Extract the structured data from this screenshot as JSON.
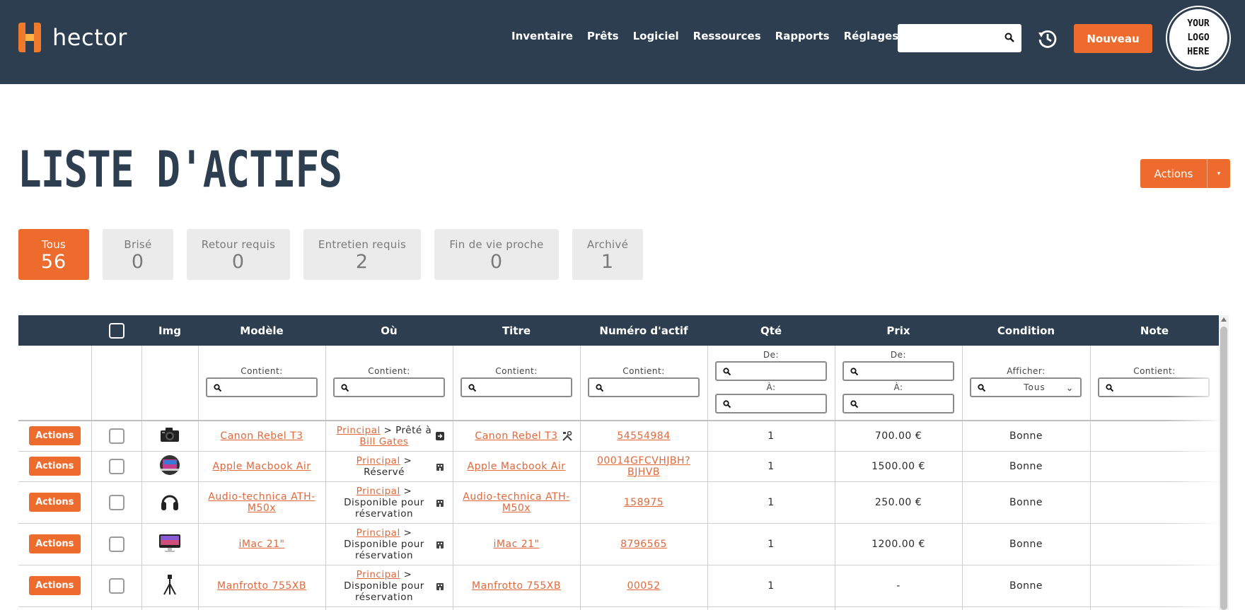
{
  "header": {
    "brand": "hector",
    "nav": [
      "Inventaire",
      "Prêts",
      "Logiciel",
      "Ressources",
      "Rapports",
      "Réglages"
    ],
    "search_placeholder": "",
    "new_button": "Nouveau",
    "logo_text": "YOUR\nLOGO\nHERE"
  },
  "page": {
    "title": "LISTE D'ACTIFS",
    "actions_button": "Actions",
    "actions_caret": "▾"
  },
  "tiles": [
    {
      "label": "Tous",
      "count": "56"
    },
    {
      "label": "Brisé",
      "count": "0"
    },
    {
      "label": "Retour requis",
      "count": "0"
    },
    {
      "label": "Entretien requis",
      "count": "2"
    },
    {
      "label": "Fin de vie proche",
      "count": "0"
    },
    {
      "label": "Archivé",
      "count": "1"
    }
  ],
  "table": {
    "columns": [
      "",
      "",
      "Img",
      "Modèle",
      "Où",
      "Titre",
      "Numéro d'actif",
      "Qté",
      "Prix",
      "Condition",
      "Note"
    ],
    "filters": {
      "contains_label": "Contient:",
      "from_label": "De:",
      "to_label": "À:",
      "show_label": "Afficher:",
      "show_value": "Tous"
    },
    "row_action_label": "Actions",
    "rows": [
      {
        "img": "camera-icon",
        "model": "Canon Rebel T3",
        "where_link": "Principal",
        "where_sep": " > Prêté à ",
        "where_user": "Bill Gates",
        "where_icon": "loan-out-icon",
        "title": "Canon Rebel T3",
        "title_icon": "maintenance-tools-icon",
        "asset": "54554984",
        "qty": "1",
        "price": "700.00 €",
        "condition": "Bonne",
        "note": ""
      },
      {
        "img": "laptop-icon",
        "model": "Apple Macbook Air",
        "where_link": "Principal",
        "where_sep": " > Réservé",
        "where_user": "",
        "where_icon": "building-icon",
        "title": "Apple Macbook Air",
        "title_icon": "",
        "asset": "00014GFCVHJBH?BJHVB",
        "qty": "1",
        "price": "1500.00 €",
        "condition": "Bonne",
        "note": ""
      },
      {
        "img": "headphones-icon",
        "model": "Audio-technica ATH-M50x",
        "where_link": "Principal",
        "where_sep": " > Disponible pour réservation",
        "where_user": "",
        "where_icon": "building-icon",
        "title": "Audio-technica ATH-M50x",
        "title_icon": "",
        "asset": "158975",
        "qty": "1",
        "price": "250.00 €",
        "condition": "Bonne",
        "note": ""
      },
      {
        "img": "imac-icon",
        "model": "iMac 21\"",
        "where_link": "Principal",
        "where_sep": " > Disponible pour réservation",
        "where_user": "",
        "where_icon": "building-icon",
        "title": "iMac 21\"",
        "title_icon": "",
        "asset": "8796565",
        "qty": "1",
        "price": "1200.00 €",
        "condition": "Bonne",
        "note": ""
      },
      {
        "img": "tripod-icon",
        "model": "Manfrotto 755XB",
        "where_link": "Principal",
        "where_sep": " > Disponible pour réservation",
        "where_user": "",
        "where_icon": "building-icon",
        "title": "Manfrotto 755XB",
        "title_icon": "",
        "asset": "00052",
        "qty": "1",
        "price": "-",
        "condition": "Bonne",
        "note": ""
      }
    ]
  },
  "colors": {
    "header_bg": "#2c3e4f",
    "accent": "#ee6b2e",
    "tile_bg": "#ebebeb",
    "link": "#e0683b"
  }
}
